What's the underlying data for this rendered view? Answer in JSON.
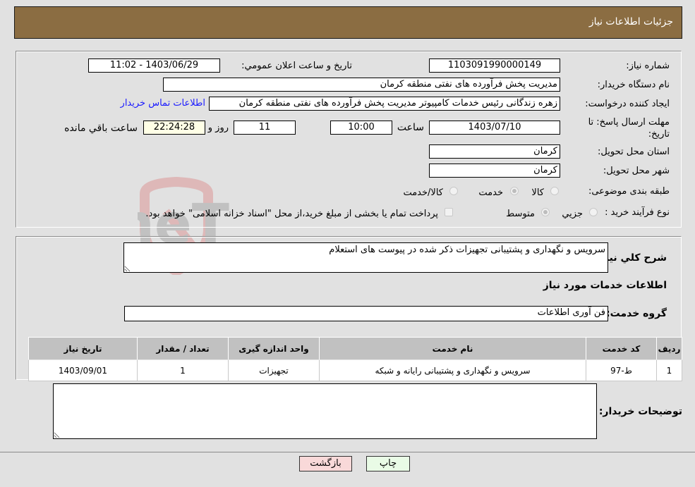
{
  "header": {
    "title": "جزئیات اطلاعات نیاز"
  },
  "details": {
    "need_number_label": "شماره نیاز:",
    "need_number": "1103091990000149",
    "announce_label": "تاریخ و ساعت اعلان عمومي:",
    "announce_value": "1403/06/29 - 11:02",
    "buyer_org_label": "نام دستگاه خریدار:",
    "buyer_org": "مدیریت پخش فرآورده های نفتی منطقه کرمان",
    "creator_label": "ایجاد کننده درخواست:",
    "creator": "زهره زندگانی رئیس خدمات کامپیوتر مدیریت پخش فرآورده های نفتی منطقه کرمان",
    "contact_link": "اطلاعات تماس خریدار",
    "deadline_label": "مهلت ارسال پاسخ: تا تاریخ:",
    "deadline_date": "1403/07/10",
    "time_label": "ساعت",
    "deadline_time": "10:00",
    "days_value": "11",
    "days_label": "روز و",
    "remaining_time": "22:24:28",
    "remaining_label": "ساعت باقي مانده",
    "province_label": "استان محل تحویل:",
    "province": "کرمان",
    "city_label": "شهر محل تحویل:",
    "city": "کرمان",
    "category_label": "طبقه بندی موضوعی:",
    "category_options": [
      "کالا",
      "خدمت",
      "کالا/خدمت"
    ],
    "category_selected": "خدمت",
    "process_label": "نوع فرآیند خرید :",
    "process_options": [
      "جزیي",
      "متوسط"
    ],
    "process_selected": "متوسط",
    "treasury_note": "پرداخت تمام یا بخشی از مبلغ خرید،از محل \"اسناد خزانه اسلامی\" خواهد بود."
  },
  "services": {
    "summary_label": "شرح كلي نياز:",
    "summary_value": "سرویس و نگهداری و پشتیبانی تجهیزات ذکر شده در پیوست های استعلام",
    "section_title": "اطلاعات خدمات مورد نیاز",
    "group_label": "گروه خدمت:",
    "group_value": "فن آوری اطلاعات",
    "table": {
      "columns": [
        "ردیف",
        "کد خدمت",
        "نام خدمت",
        "واحد اندازه گیری",
        "تعداد / مقدار",
        "تاریخ نیاز"
      ],
      "rows": [
        [
          "1",
          "ط-97",
          "سرویس و نگهداری و پشتیبانی رایانه و شبکه",
          "تجهیزات",
          "1",
          "1403/09/01"
        ]
      ]
    },
    "buyer_notes_label": "توضیحات خریدار:",
    "buyer_notes_value": ""
  },
  "buttons": {
    "print": "چاپ",
    "back": "بازگشت"
  },
  "watermark": {
    "text": "AriaTender.neT"
  },
  "colors": {
    "header": "#8b6d42",
    "print_bg": "#e9fbe6",
    "back_bg": "#f9d9d9",
    "link": "#1a1aff"
  }
}
